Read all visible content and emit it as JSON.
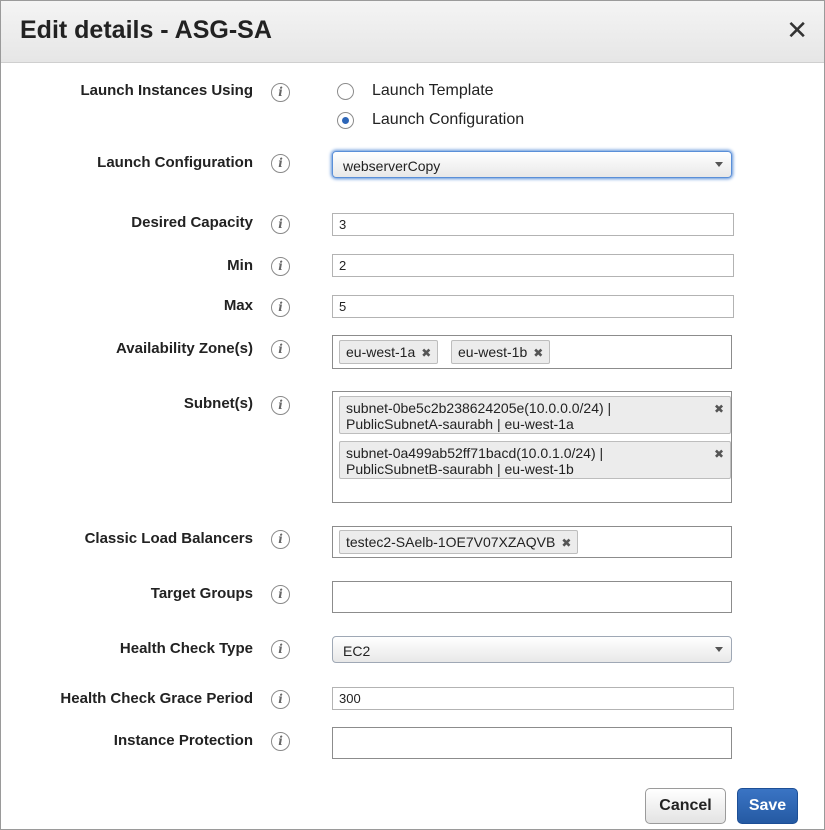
{
  "dialog": {
    "title": "Edit details - ASG-SA",
    "close_glyph": "✕"
  },
  "info_glyph": "i",
  "launch_using": {
    "label": "Launch Instances Using",
    "options": [
      "Launch Template",
      "Launch Configuration"
    ],
    "selected": "Launch Configuration"
  },
  "launch_configuration": {
    "label": "Launch Configuration",
    "value": "webserverCopy"
  },
  "desired_capacity": {
    "label": "Desired Capacity",
    "value": "3"
  },
  "min": {
    "label": "Min",
    "value": "2"
  },
  "max": {
    "label": "Max",
    "value": "5"
  },
  "availability_zones": {
    "label": "Availability Zone(s)",
    "tags": [
      "eu-west-1a",
      "eu-west-1b"
    ]
  },
  "subnets": {
    "label": "Subnet(s)",
    "items": [
      {
        "line1": "subnet-0be5c2b238624205e(10.0.0.0/24) |",
        "line2": "PublicSubnetA-saurabh | eu-west-1a"
      },
      {
        "line1": "subnet-0a499ab52ff71bacd(10.0.1.0/24) |",
        "line2": "PublicSubnetB-saurabh | eu-west-1b"
      }
    ]
  },
  "classic_load_balancers": {
    "label": "Classic Load Balancers",
    "tags": [
      "testec2-SAelb-1OE7V07XZAQVB"
    ]
  },
  "target_groups": {
    "label": "Target Groups"
  },
  "health_check_type": {
    "label": "Health Check Type",
    "value": "EC2"
  },
  "health_check_grace_period": {
    "label": "Health Check Grace Period",
    "value": "300"
  },
  "instance_protection": {
    "label": "Instance Protection"
  },
  "tag_remove_glyph": "✖",
  "buttons": {
    "cancel": "Cancel",
    "save": "Save"
  },
  "colors": {
    "primary": "#2d66b8",
    "header_bg": "#ececec"
  }
}
